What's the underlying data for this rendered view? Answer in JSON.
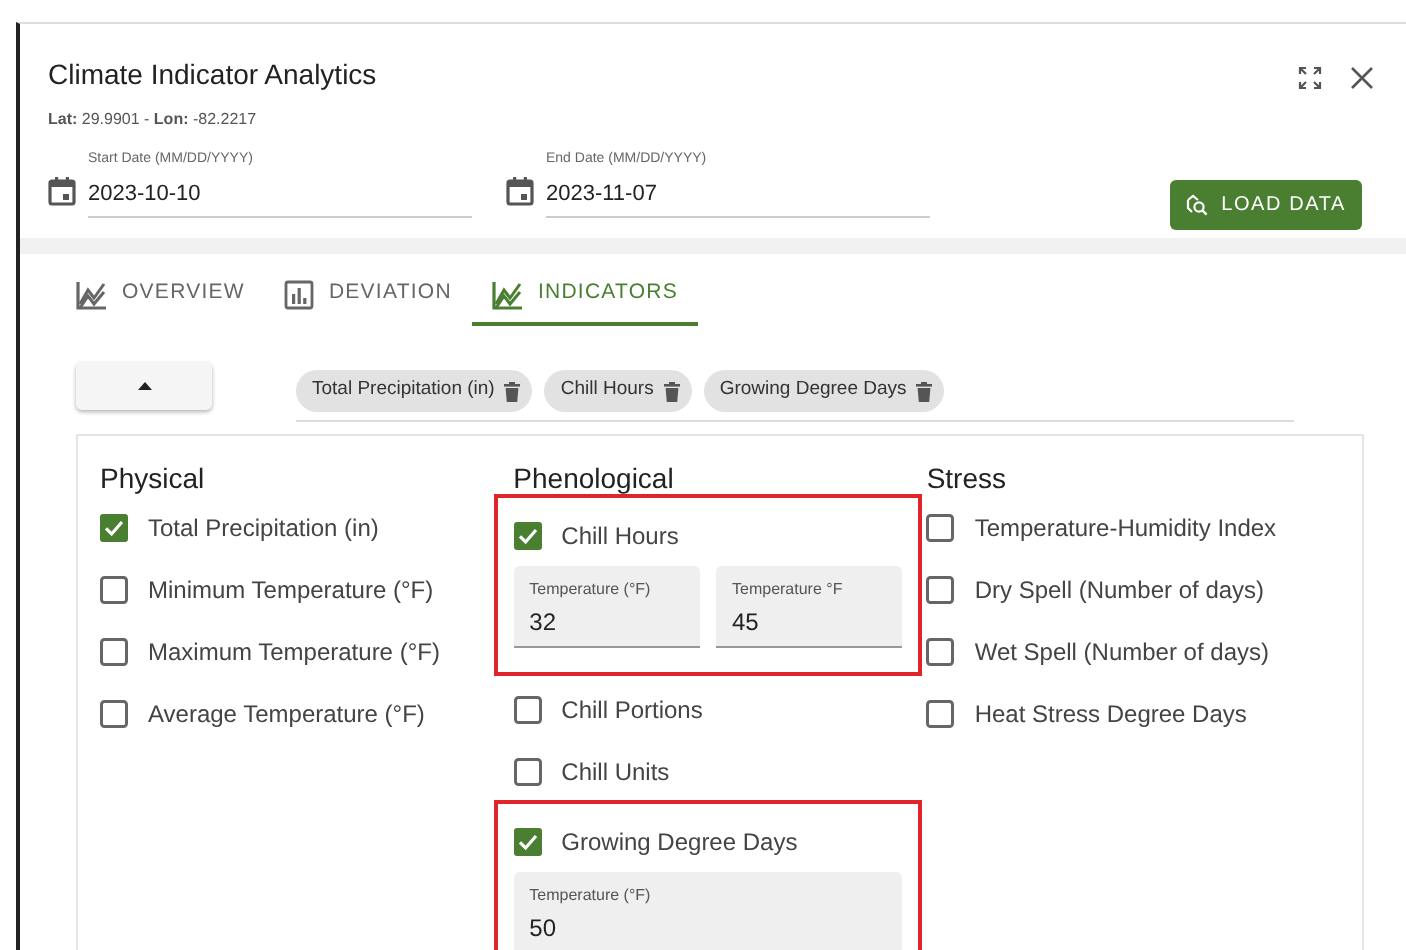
{
  "dialog": {
    "title": "Climate Indicator Analytics",
    "coordinates": "**Lat:** 29.9901 - **Lon:** -82.2217"
  },
  "date_fields": [
    {
      "label": "Start Date (MM/DD/YYYY)",
      "value": "2023-10-10"
    },
    {
      "label": "End Date (MM/DD/YYYY)",
      "value": "2023-11-07"
    }
  ],
  "load_button": "LOAD DATA",
  "tabs": [
    {
      "label": "OVERVIEW",
      "kind": "line",
      "selected": false
    },
    {
      "label": "DEVIATION",
      "kind": "bar",
      "selected": false
    },
    {
      "label": "INDICATORS",
      "kind": "line",
      "selected": true
    }
  ],
  "chips": [
    "Total Precipitation (in)",
    "Chill Hours",
    "Growing Degree Days"
  ],
  "groups": [
    {
      "title": "Physical",
      "items": [
        {
          "label": "Total Precipitation (in)",
          "checked": true,
          "highlighted": false
        },
        {
          "label": "Minimum Temperature (°F)",
          "checked": false,
          "highlighted": false
        },
        {
          "label": "Maximum Temperature (°F)",
          "checked": false,
          "highlighted": false
        },
        {
          "label": "Average Temperature (°F)",
          "checked": false,
          "highlighted": false
        }
      ]
    },
    {
      "title": "Phenological",
      "items": [
        {
          "label": "Chill Hours",
          "checked": true,
          "highlighted": true,
          "fields": [
            {
              "label": "Temperature (°F)",
              "value": "32"
            },
            {
              "label": "Temperature °F",
              "value": "45"
            }
          ]
        },
        {
          "label": "Chill Portions",
          "checked": false,
          "highlighted": false
        },
        {
          "label": "Chill Units",
          "checked": false,
          "highlighted": false
        },
        {
          "label": "Growing Degree Days",
          "checked": true,
          "highlighted": true,
          "fields": [
            {
              "label": "Temperature (°F)",
              "value": "50"
            }
          ]
        }
      ]
    },
    {
      "title": "Stress",
      "items": [
        {
          "label": "Temperature-Humidity Index",
          "checked": false,
          "highlighted": false
        },
        {
          "label": "Dry Spell (Number of days)",
          "checked": false,
          "highlighted": false
        },
        {
          "label": "Wet Spell (Number of days)",
          "checked": false,
          "highlighted": false
        },
        {
          "label": "Heat Stress Degree Days",
          "checked": false,
          "highlighted": false
        }
      ]
    }
  ]
}
